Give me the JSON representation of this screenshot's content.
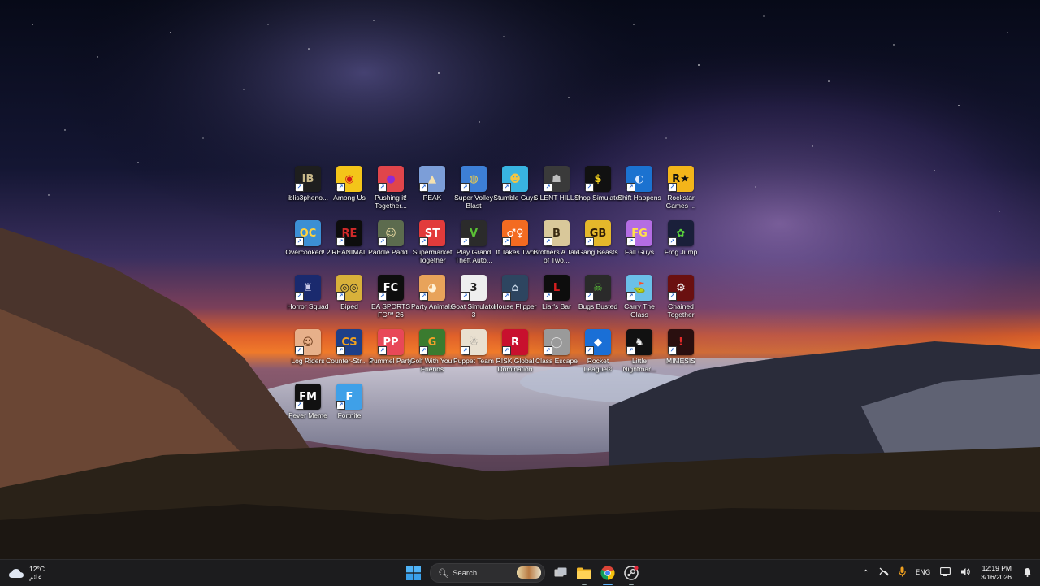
{
  "desktop": {
    "icons": [
      {
        "label": "iblis3pheno...",
        "color": "#1e1e1e",
        "glyph": "IB",
        "fg": "#c9b98a"
      },
      {
        "label": "Among Us",
        "color": "#f4c519",
        "glyph": "◉",
        "fg": "#d51a1a"
      },
      {
        "label": "Pushing it! Together...",
        "color": "#e0454b",
        "glyph": "●",
        "fg": "#8e2bd6"
      },
      {
        "label": "PEAK",
        "color": "#7c9ed8",
        "glyph": "▲",
        "fg": "#f4e1b0"
      },
      {
        "label": "Super Volley Blast",
        "color": "#3d7fd6",
        "glyph": "◍",
        "fg": "#f1d04b"
      },
      {
        "label": "Stumble Guys",
        "color": "#38b3e0",
        "glyph": "☻",
        "fg": "#f5c542"
      },
      {
        "label": "SILENT HILL 2",
        "color": "#3a3a3a",
        "glyph": "☗",
        "fg": "#bdbdbd"
      },
      {
        "label": "Shop Simulator",
        "color": "#111111",
        "glyph": "$",
        "fg": "#f3d21f"
      },
      {
        "label": "Shift Happens",
        "color": "#1b72d0",
        "glyph": "◐",
        "fg": "#d8e8ff"
      },
      {
        "label": "Rockstar Games ...",
        "color": "#f3b51a",
        "glyph": "R★",
        "fg": "#111111"
      },
      {
        "label": "Overcooked! 2",
        "color": "#3c8fd4",
        "glyph": "OC",
        "fg": "#ffd23f"
      },
      {
        "label": "REANIMAL",
        "color": "#0d0d0d",
        "glyph": "RE",
        "fg": "#d22a2a"
      },
      {
        "label": "Paddle Padd...",
        "color": "#5c6b4e",
        "glyph": "☺",
        "fg": "#e8d8a0"
      },
      {
        "label": "Supermarket Together",
        "color": "#e23b3b",
        "glyph": "ST",
        "fg": "#ffffff"
      },
      {
        "label": "Play Grand Theft Auto...",
        "color": "#2b2b2b",
        "glyph": "V",
        "fg": "#5bc236"
      },
      {
        "label": "It Takes Two",
        "color": "#f36b21",
        "glyph": "♂♀",
        "fg": "#ffffff"
      },
      {
        "label": "Brothers A Tale of Two...",
        "color": "#d9c89a",
        "glyph": "B",
        "fg": "#3a2b12"
      },
      {
        "label": "Gang Beasts",
        "color": "#e4b72b",
        "glyph": "GB",
        "fg": "#2b1a07"
      },
      {
        "label": "Fall Guys",
        "color": "#b46de3",
        "glyph": "FG",
        "fg": "#ffe14a"
      },
      {
        "label": "Frog Jump",
        "color": "#1a1f3a",
        "glyph": "✿",
        "fg": "#58d13b"
      },
      {
        "label": "Horror Squad",
        "color": "#1a2a6e",
        "glyph": "♜",
        "fg": "#c9c9e8"
      },
      {
        "label": "Biped",
        "color": "#d8b13a",
        "glyph": "◎◎",
        "fg": "#222222"
      },
      {
        "label": "EA SPORTS FC™ 26",
        "color": "#0e0e0e",
        "glyph": "FC",
        "fg": "#ffffff"
      },
      {
        "label": "Party Animals",
        "color": "#e8a35a",
        "glyph": "◕",
        "fg": "#fff1d6"
      },
      {
        "label": "Goat Simulator 3",
        "color": "#eeeeee",
        "glyph": "3",
        "fg": "#222222"
      },
      {
        "label": "House Flipper",
        "color": "#2d4560",
        "glyph": "⌂",
        "fg": "#c9d8e8"
      },
      {
        "label": "Liar's Bar",
        "color": "#0d0d0d",
        "glyph": "L",
        "fg": "#d31f1f"
      },
      {
        "label": "Bugs Busted",
        "color": "#2a2a2a",
        "glyph": "☠",
        "fg": "#5fce3b"
      },
      {
        "label": "Carry The Glass",
        "color": "#6bc0e8",
        "glyph": "⛳",
        "fg": "#ffffff"
      },
      {
        "label": "Chained Together",
        "color": "#6a1010",
        "glyph": "⚙",
        "fg": "#f0f0f0"
      },
      {
        "label": "Log Riders",
        "color": "#e7b08a",
        "glyph": "☺",
        "fg": "#6b3a1a"
      },
      {
        "label": "Counter-Str... 2",
        "color": "#1e3f88",
        "glyph": "CS",
        "fg": "#f2a21e"
      },
      {
        "label": "Pummel Party",
        "color": "#e84858",
        "glyph": "PP",
        "fg": "#ffffff"
      },
      {
        "label": "Golf With Your Friends",
        "color": "#3a7b2f",
        "glyph": "G",
        "fg": "#f3a12a"
      },
      {
        "label": "Puppet Team",
        "color": "#e9e0d0",
        "glyph": "☃",
        "fg": "#777777"
      },
      {
        "label": "RISK Global Domination",
        "color": "#c8102e",
        "glyph": "R",
        "fg": "#ffffff"
      },
      {
        "label": "Class Escape",
        "color": "#9a9a9a",
        "glyph": "◯",
        "fg": "#e0e0e0"
      },
      {
        "label": "Rocket League®",
        "color": "#1a6fd6",
        "glyph": "◆",
        "fg": "#ffffff"
      },
      {
        "label": "Little Nightmar...",
        "color": "#111111",
        "glyph": "♞",
        "fg": "#eeeeee"
      },
      {
        "label": "MIMESIS",
        "color": "#2a0f0f",
        "glyph": "!",
        "fg": "#e42a2a"
      },
      {
        "label": "Fever Meme",
        "color": "#111111",
        "glyph": "FM",
        "fg": "#ffffff"
      },
      {
        "label": "Fortnite",
        "color": "#3fa0e8",
        "glyph": "F",
        "fg": "#ffffff"
      }
    ]
  },
  "taskbar": {
    "weather": {
      "temp": "12°C",
      "condition": "غائم",
      "icon": "cloud-icon"
    },
    "search": {
      "placeholder": "Search"
    },
    "start": {
      "icon": "windows-start-icon"
    },
    "apps": [
      {
        "name": "task-view",
        "icon": "task-view-icon"
      },
      {
        "name": "file-explorer",
        "icon": "folder-icon"
      },
      {
        "name": "chrome",
        "icon": "chrome-icon"
      },
      {
        "name": "steam",
        "icon": "steam-icon"
      }
    ],
    "tray": {
      "language": "ENG",
      "time": "12:19 PM",
      "date": "3/16/2026"
    }
  },
  "colors": {
    "taskbar_bg": "#1c1c1e",
    "accent": "#60b6ff"
  }
}
